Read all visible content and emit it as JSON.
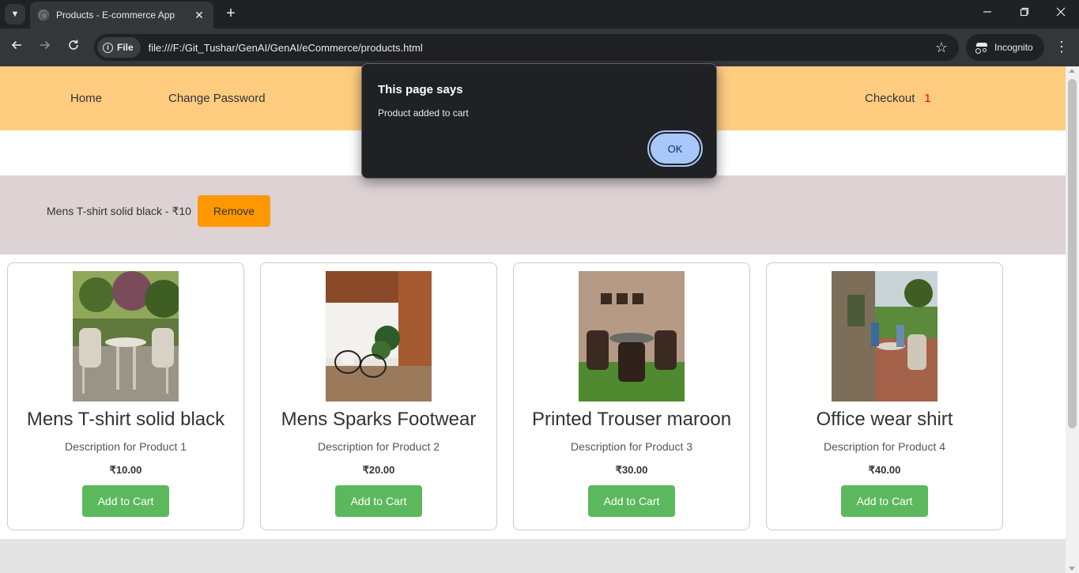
{
  "browser": {
    "tab_title": "Products - E-commerce App",
    "close_tab": "✕",
    "new_tab": "+",
    "file_chip": "File",
    "url": "file:///F:/Git_Tushar/GenAI/GenAI/eCommerce/products.html",
    "incognito_label": "Incognito"
  },
  "nav": {
    "home": "Home",
    "change_password": "Change Password",
    "checkout": "Checkout",
    "cart_count": "1"
  },
  "cart": {
    "item_text": "Mens T-shirt solid black - ₹10",
    "remove_label": "Remove"
  },
  "products": [
    {
      "title": "Mens T-shirt solid black",
      "description": "Description for Product 1",
      "price": "₹10.00",
      "button": "Add to Cart"
    },
    {
      "title": "Mens Sparks Footwear",
      "description": "Description for Product 2",
      "price": "₹20.00",
      "button": "Add to Cart"
    },
    {
      "title": "Printed Trouser maroon",
      "description": "Description for Product 3",
      "price": "₹30.00",
      "button": "Add to Cart"
    },
    {
      "title": "Office wear shirt",
      "description": "Description for Product 4",
      "price": "₹40.00",
      "button": "Add to Cart"
    }
  ],
  "dialog": {
    "title": "This page says",
    "message": "Product added to cart",
    "ok_label": "OK"
  },
  "colors": {
    "nav_bg": "#ffcc80",
    "cart_bg": "#ddd2d4",
    "remove_btn": "#ff9800",
    "add_btn": "#5cb85c",
    "cart_count": "#ff0000",
    "dialog_ok": "#a8c7fa"
  },
  "icons": [
    "tab-search-icon",
    "globe-icon",
    "close-icon",
    "plus-icon",
    "minimize-icon",
    "restore-icon",
    "back-icon",
    "forward-icon",
    "reload-icon",
    "info-icon",
    "star-icon",
    "incognito-icon",
    "menu-icon"
  ]
}
